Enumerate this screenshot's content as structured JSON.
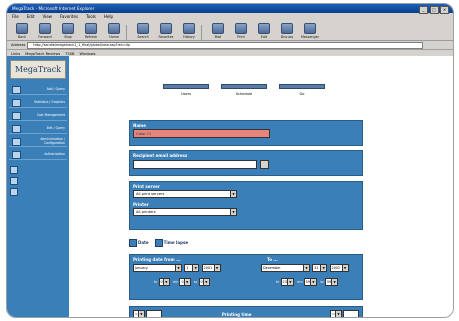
{
  "window": {
    "title": "MegaTrack - Microsoft Internet Explorer",
    "controls": [
      "_",
      "□",
      "×"
    ]
  },
  "menu": [
    "File",
    "Edit",
    "View",
    "Favorites",
    "Tools",
    "Help"
  ],
  "toolbar": [
    {
      "label": "Back",
      "icon": "back-arrow-icon"
    },
    {
      "label": "Forward",
      "icon": "forward-arrow-icon"
    },
    {
      "label": "Stop",
      "icon": "stop-icon"
    },
    {
      "label": "Refresh",
      "icon": "refresh-icon"
    },
    {
      "label": "Home",
      "icon": "home-icon"
    },
    {
      "label": "Search",
      "icon": "search-icon"
    },
    {
      "label": "Favorites",
      "icon": "favorites-icon"
    },
    {
      "label": "History",
      "icon": "history-icon"
    },
    {
      "label": "Mail",
      "icon": "mail-icon"
    },
    {
      "label": "Print",
      "icon": "print-icon"
    },
    {
      "label": "Edit",
      "icon": "edit-icon"
    },
    {
      "label": "Discuss",
      "icon": "discuss-icon"
    },
    {
      "label": "Messenger",
      "icon": "messenger-icon"
    }
  ],
  "address": {
    "label": "Address",
    "value": "http://sandie/megatrack1_1_final/global/new.asp?res=dp"
  },
  "links": {
    "label": "Links",
    "items": [
      "MegaTrack Reviews",
      "TSSB",
      "Windows"
    ]
  },
  "sidebar": {
    "logo": "MegaTrack",
    "items": [
      "Add / Query",
      "Statistics / Graphics",
      "Cost Management",
      "Edit / Query",
      "Administration / Configuration",
      "Authorization"
    ]
  },
  "tabs": [
    "Users",
    "Schedule",
    "Go"
  ],
  "form": {
    "name_label": "Name",
    "name_value": "Color Cl",
    "email_label": "Recipient email address",
    "email_value": "",
    "print_server_label": "Print server",
    "print_server_value": "All print servers",
    "printer_label": "Printer",
    "printer_value": "All printers",
    "date_label": "Date",
    "time_label": "Time lapse",
    "from_label": "Printing date from ...",
    "to_label": "To ...",
    "from_month": "January",
    "from_day": "1",
    "from_year": "2001",
    "to_month": "December",
    "to_day": "31",
    "to_year": "2002",
    "hrs_label": "hr",
    "min_label": "mn",
    "sec_label": "sc",
    "from_hr": "0",
    "from_mn": "0",
    "from_sc": "0",
    "to_hr": "23",
    "to_mn": "59",
    "to_sc": "59",
    "bottom_left_op": "=",
    "bottom_label": "Printing time",
    "bottom_right_op": "="
  }
}
